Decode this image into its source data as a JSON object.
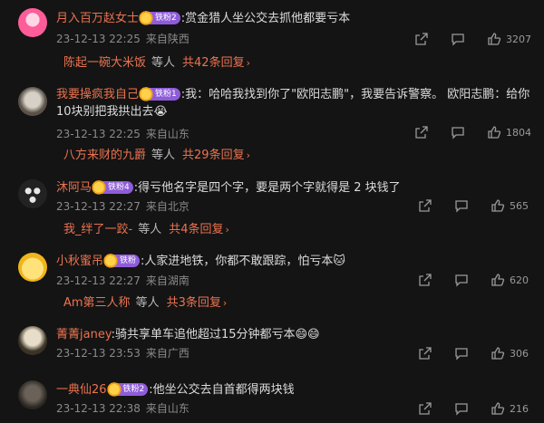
{
  "comments": [
    {
      "user": "月入百万赵女士",
      "badge": "铁粉2",
      "text": ":赏金猎人坐公交去抓他都要亏本",
      "date": "23-12-13 22:25",
      "location": "来自陕西",
      "likes": "3207",
      "avatar_colors": [
        "#ff5c9a",
        "#ffd6e6"
      ],
      "reply": {
        "user": "陈起一碗大米饭",
        "mid": "等人",
        "total": "共42条回复"
      }
    },
    {
      "user": "我要操疯我自己",
      "badge": "铁粉1",
      "text": ":我：哈哈我找到你了\"欧阳志鹏\"，我要告诉警察。 欧阳志鹏：给你10块别把我拱出去😭",
      "date": "23-12-13 22:25",
      "location": "来自山东",
      "likes": "1804",
      "avatar_colors": [
        "#b9b2a6",
        "#5a5148"
      ],
      "reply": {
        "user": "八方来财的九爵",
        "mid": "等人",
        "total": "共29条回复"
      }
    },
    {
      "user": "沐阿马",
      "badge": "铁粉4",
      "text": ":得亏他名字是四个字，要是两个字就得是 2 块钱了",
      "date": "23-12-13 22:27",
      "location": "来自北京",
      "likes": "565",
      "avatar_colors": [
        "#e6e6e6",
        "#222"
      ],
      "reply": {
        "user": "我_绊了一跤-",
        "mid": "等人",
        "total": "共4条回复"
      }
    },
    {
      "user": "小秋蜜吊",
      "badge": "铁粉",
      "text": ":人家进地铁，你都不敢跟踪，怕亏本🐱",
      "date": "23-12-13 22:27",
      "location": "来自湖南",
      "likes": "620",
      "avatar_colors": [
        "#ffd83a",
        "#f3c12a"
      ],
      "reply": {
        "user": "Am第三人称",
        "mid": "等人",
        "total": "共3条回复"
      }
    },
    {
      "user": "菁菁janey",
      "badge": "",
      "text": ":骑共享单车追他超过15分钟都亏本😄😄",
      "date": "23-12-13 23:53",
      "location": "来自广西",
      "likes": "306",
      "avatar_colors": [
        "#d9cdb4",
        "#3a3326"
      ],
      "reply": null
    },
    {
      "user": "一典仙26",
      "badge": "铁粉2",
      "text": ":他坐公交去自首都得两块钱",
      "date": "23-12-13 22:38",
      "location": "来自山东",
      "likes": "216",
      "avatar_colors": [
        "#5a524a",
        "#2a2622"
      ],
      "reply": null
    }
  ],
  "icons": [
    "share-icon",
    "comment-icon",
    "like-icon"
  ]
}
